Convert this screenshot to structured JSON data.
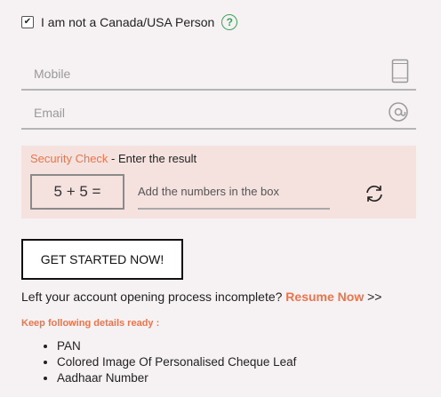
{
  "checkbox": {
    "label": "I am not a Canada/USA Person",
    "checked": true,
    "check_mark": "✔",
    "help_symbol": "?"
  },
  "form": {
    "mobile_placeholder": "Mobile",
    "email_placeholder": "Email"
  },
  "security": {
    "title_accent": "Security Check",
    "title_rest": " - Enter the result",
    "captcha": "5 + 5 =",
    "input_placeholder": "Add the numbers in the box"
  },
  "cta_label": "GET STARTED NOW!",
  "resume": {
    "prefix": "Left your account opening process incomplete? ",
    "link": "Resume Now",
    "suffix": " >>"
  },
  "keep_ready": {
    "title": "Keep following details ready :",
    "items": [
      "PAN",
      "Colored Image Of Personalised Cheque Leaf",
      "Aadhaar Number"
    ]
  },
  "colors": {
    "accent": "#e8754c",
    "help_green": "#3aa35a",
    "security_bg": "#f5e2df",
    "page_bg": "#f6f1f2"
  }
}
